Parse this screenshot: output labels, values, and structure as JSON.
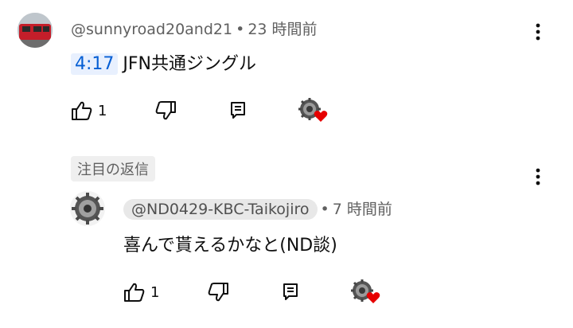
{
  "comment": {
    "author": "@sunnyroad20and21",
    "separator": "•",
    "time": "23 時間前",
    "timestamp_link": "4:17",
    "text": "JFN共通ジングル",
    "like_count": "1"
  },
  "section_label": "注目の返信",
  "reply": {
    "author": "@ND0429-KBC-Taikojiro",
    "separator": "•",
    "time": "7 時間前",
    "text": "喜んで貰えるかなと(ND談)",
    "like_count": "1"
  },
  "icons": {
    "like": "thumbs-up-icon",
    "dislike": "thumbs-down-icon",
    "reply": "comment-reply-icon",
    "heart": "creator-heart-icon",
    "more": "more-vert-icon"
  },
  "colors": {
    "link": "#065fd4",
    "heart": "#e60000",
    "meta": "#606060"
  }
}
